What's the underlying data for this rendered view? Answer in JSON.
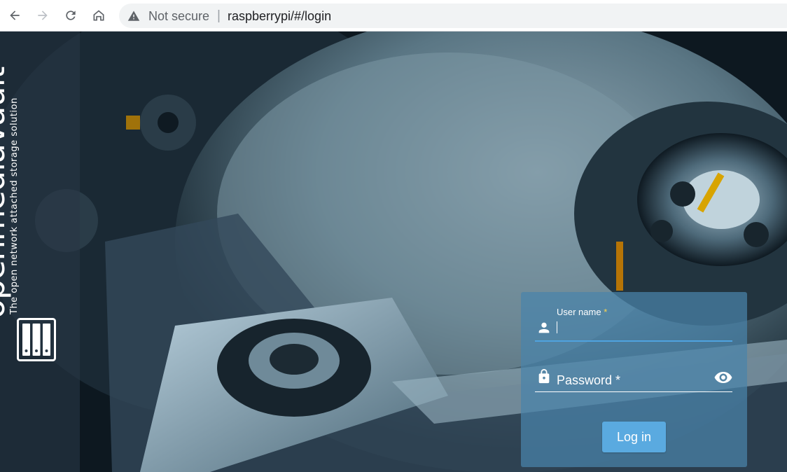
{
  "browser": {
    "security_text": "Not secure",
    "separator": "|",
    "url": "raspberrypi/#/login"
  },
  "brand": {
    "name": "openmediavault",
    "tagline": "The open network attached storage solution"
  },
  "login": {
    "username_label": "User name",
    "required_mark": "*",
    "password_placeholder": "Password *",
    "login_button": "Log in"
  },
  "colors": {
    "sidebar": "#2a3a48",
    "card": "#4a84aa",
    "button": "#5aaae0",
    "focus_line": "#4fa3e0",
    "required": "#ffd54f"
  },
  "icons": {
    "back": "arrow-left-icon",
    "forward": "arrow-right-icon",
    "reload": "reload-icon",
    "home": "home-icon",
    "warning": "warning-icon",
    "user": "person-icon",
    "lock": "lock-icon",
    "show_password": "eye-icon",
    "logo": "nas-drives-icon"
  }
}
